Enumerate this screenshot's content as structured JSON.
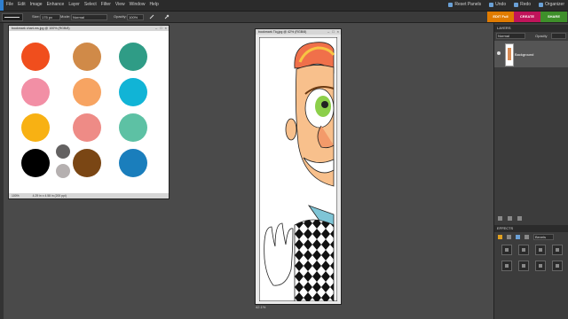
{
  "menubar": {
    "items": [
      "File",
      "Edit",
      "Image",
      "Enhance",
      "Layer",
      "Select",
      "Filter",
      "View",
      "Window",
      "Help"
    ],
    "right": [
      "Reset Panels",
      "Undo",
      "Redo",
      "Organizer"
    ]
  },
  "options": {
    "size_label": "Size:",
    "size_value": "175 px",
    "mode_label": "Mode:",
    "mode_value": "Normal",
    "opacity_label": "Opacity:",
    "opacity_value": "100%"
  },
  "tabs": [
    {
      "label": "EDIT Full",
      "color": "#e07b00"
    },
    {
      "label": "CREATE",
      "color": "#c0145a"
    },
    {
      "label": "SHARE",
      "color": "#3e8f2a"
    }
  ],
  "doc1": {
    "title": "bookmark chart-ms.jpg @ 100% (RGB/8)",
    "status_zoom": "100%",
    "status_info": "4.29 in x 4.58 in (200 ppi)"
  },
  "doc2": {
    "title": "bookmark Tiq.jpg @ 42% (RGB/8)",
    "status_zoom": "42.1%"
  },
  "palette": [
    "#f04e1d",
    "#d08a48",
    "#2f9c86",
    "#f28fa5",
    "#f7a462",
    "#11b4d6",
    "#f8b113",
    "#ee8b86",
    "#5dc1a4",
    "#000000",
    "#636161",
    "#7a4614",
    "#1a7ebc",
    "#b5b0b0"
  ],
  "layers": {
    "header": "LAYERS",
    "blend_mode": "Normal",
    "opacity_label": "Opacity",
    "layer_name": "Background"
  },
  "effects": {
    "header": "EFFECTS",
    "filter_label": "Bevels"
  }
}
